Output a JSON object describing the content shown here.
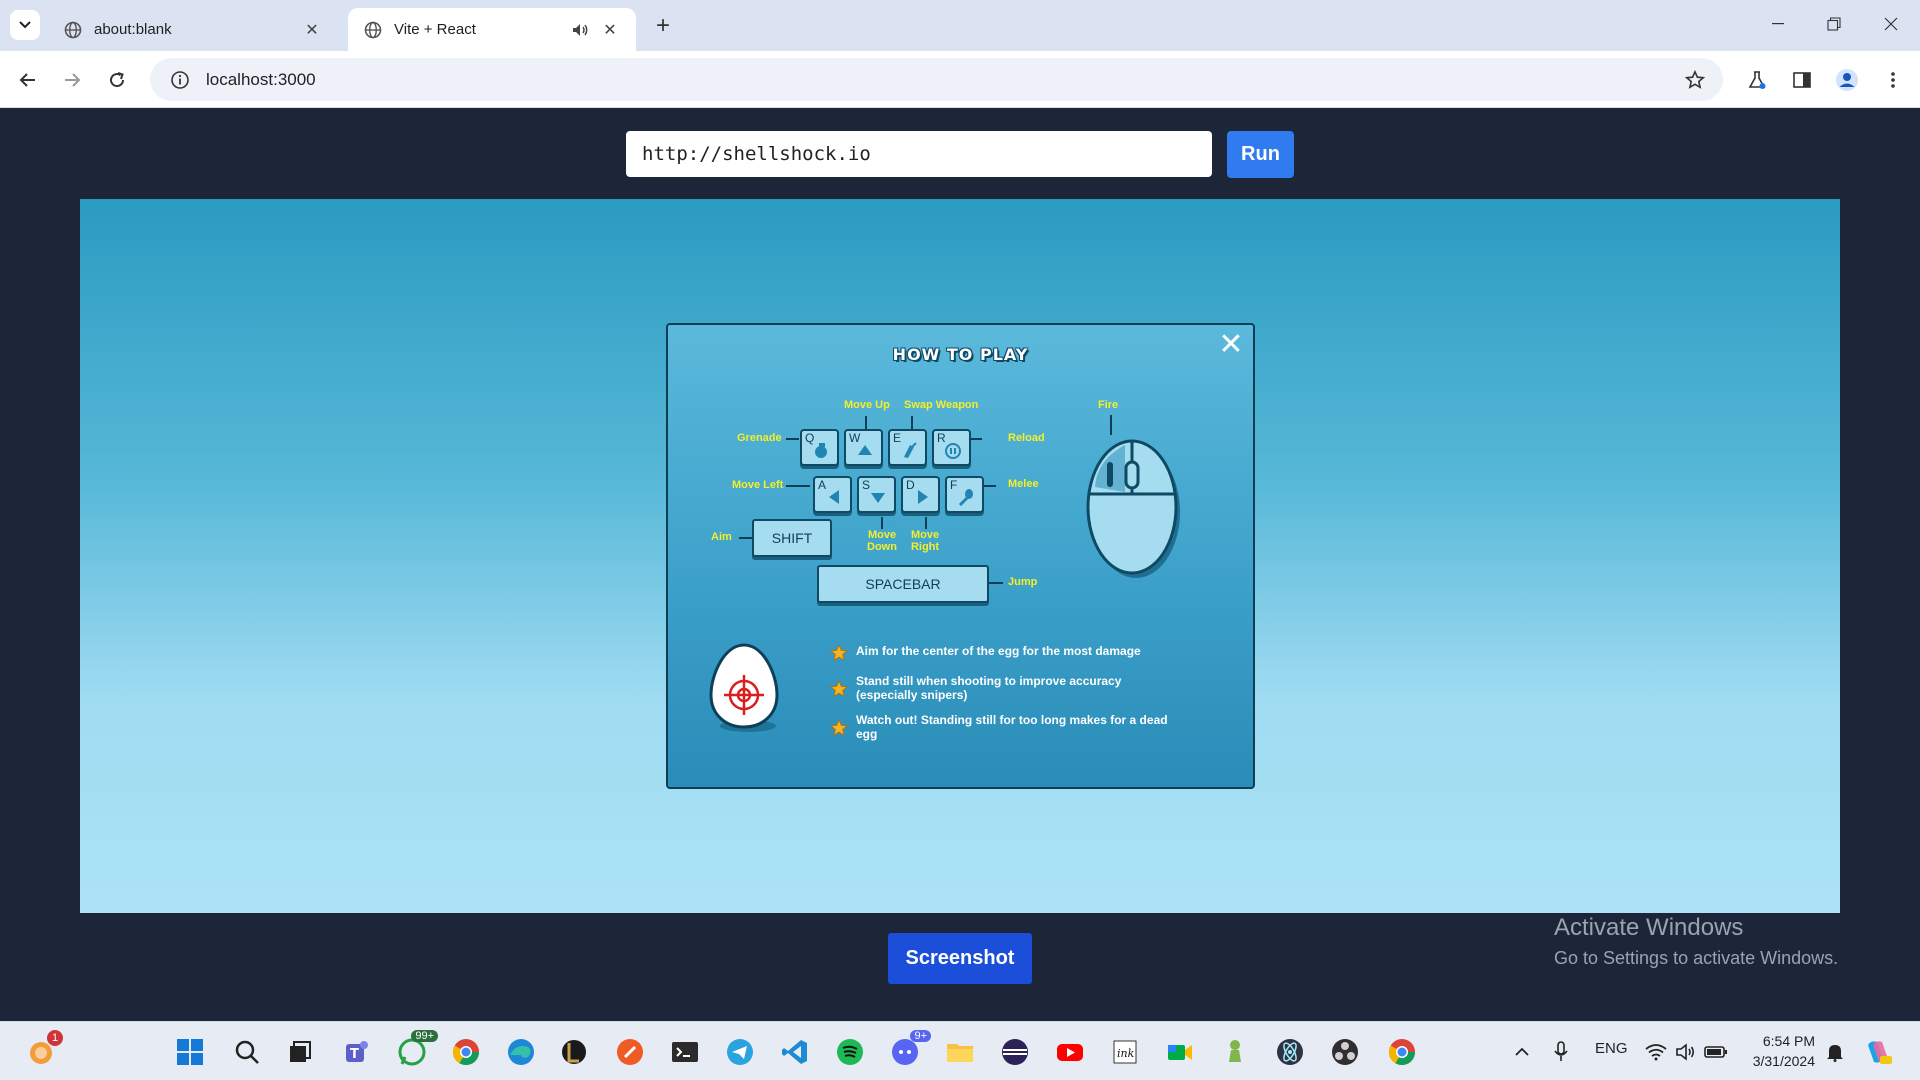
{
  "browser": {
    "tabs": [
      {
        "title": "about:blank",
        "active": false
      },
      {
        "title": "Vite + React",
        "active": true
      }
    ],
    "address": "localhost:3000"
  },
  "page": {
    "url_input_value": "http://shellshock.io",
    "run_label": "Run",
    "screenshot_label": "Screenshot"
  },
  "modal": {
    "title": "HOW TO PLAY",
    "close_label": "✕",
    "labels": {
      "grenade": "Grenade",
      "move_up": "Move Up",
      "swap_weapon": "Swap Weapon",
      "reload": "Reload",
      "move_left": "Move Left",
      "melee": "Melee",
      "aim": "Aim",
      "move_down_1": "Move",
      "move_down_2": "Down",
      "move_right_1": "Move",
      "move_right_2": "Right",
      "jump": "Jump",
      "fire": "Fire"
    },
    "keys": {
      "q": "Q",
      "w": "W",
      "e": "E",
      "r": "R",
      "a": "A",
      "s": "S",
      "d": "D",
      "f": "F",
      "shift": "SHIFT",
      "spacebar": "SPACEBAR"
    },
    "tips": [
      "Aim for the center of the egg for the most damage",
      "Stand still when shooting to improve accuracy (especially snipers)",
      "Watch out! Standing still for too long makes for a dead egg"
    ]
  },
  "watermark": {
    "line1": "Activate Windows",
    "line2": "Go to Settings to activate Windows."
  },
  "taskbar": {
    "notification_count": "1",
    "whatsapp_badge": "99+",
    "discord_badge": "9+",
    "language": "ENG",
    "time": "6:54 PM",
    "date": "3/31/2024"
  },
  "colors": {
    "page_bg": "#1d2639",
    "run_button": "#2f7bef",
    "screenshot_button": "#1b4fd9",
    "label_yellow": "#f5ef2a"
  }
}
